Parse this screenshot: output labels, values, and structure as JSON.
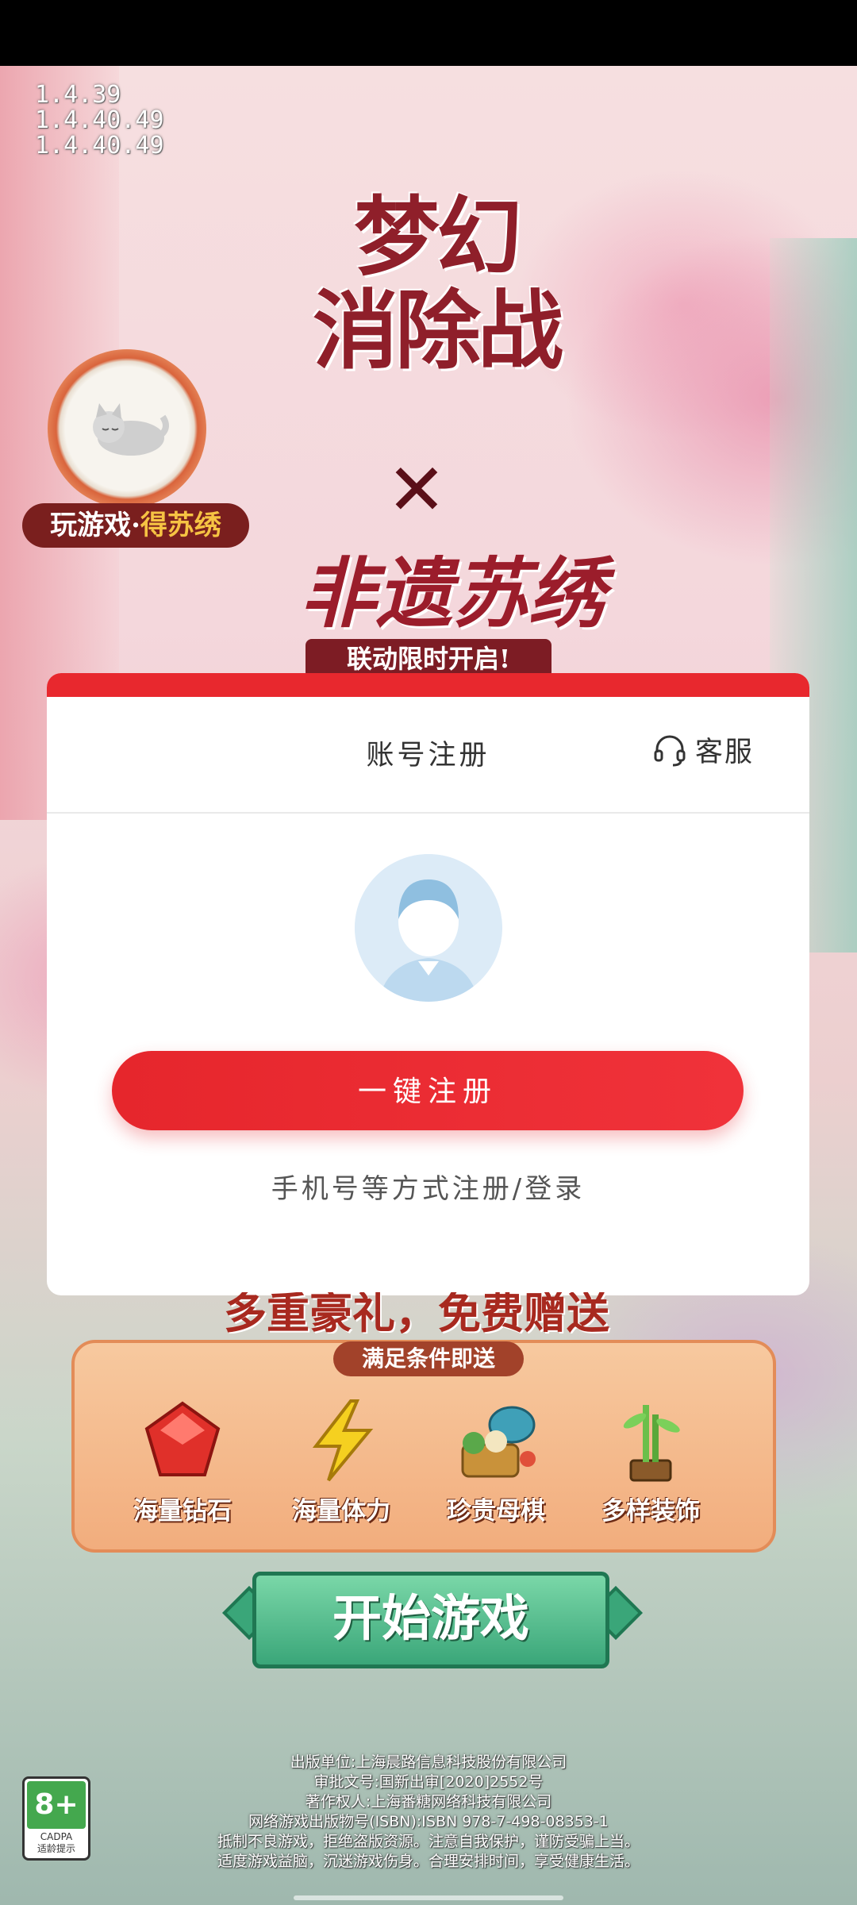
{
  "version_lines": [
    "1.4.39",
    "1.4.40.49",
    "1.4.40.49"
  ],
  "game_logo": {
    "title_line1": "梦幻",
    "title_line2": "消除战",
    "x_mark": "✕",
    "subtitle": "非遗苏绣",
    "collab_banner": "联动限时开启!"
  },
  "event_badge": {
    "part1": "玩游戏·",
    "part2": "得苏绣"
  },
  "account_panel": {
    "title": "账号注册",
    "support_label": "客服",
    "register_button": "一键注册",
    "alternative_link": "手机号等方式注册/登录"
  },
  "gifts": {
    "header": "多重豪礼，免费赠送",
    "condition": "满足条件即送",
    "items": [
      {
        "label": "海量钻石",
        "icon": "gem-icon"
      },
      {
        "label": "海量体力",
        "icon": "lightning-icon"
      },
      {
        "label": "珍贵母棋",
        "icon": "teapot-basket-icon"
      },
      {
        "label": "多样装饰",
        "icon": "bamboo-plant-icon"
      }
    ]
  },
  "start_button": "开始游戏",
  "age_rating": {
    "value": "8+",
    "org": "CADPA",
    "label": "适龄提示"
  },
  "legal_lines": [
    "出版单位:上海晨路信息科技股份有限公司",
    "审批文号:国新出审[2020]2552号",
    "著作权人:上海番糖网络科技有限公司",
    "网络游戏出版物号(ISBN):ISBN 978-7-498-08353-1",
    "抵制不良游戏，拒绝盗版资源。注意自我保护，谨防受骗上当。",
    "适度游戏益脑，沉迷游戏伤身。合理安排时间，享受健康生活。"
  ],
  "colors": {
    "accent_red": "#e8282e",
    "start_green": "#3aa679"
  }
}
